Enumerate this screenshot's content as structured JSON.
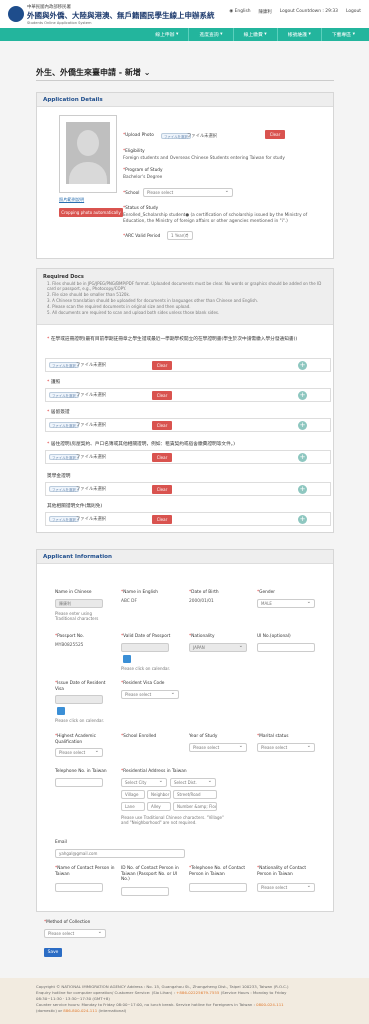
{
  "header": {
    "agency_zh": "中華民國內政部移民署",
    "system_zh": "外國與外僑、大陸與港澳、無戶籍國民學生線上申辦系統",
    "system_en": "Students Online Application System",
    "lang": "English",
    "user": "陳康利",
    "countdown_label": "Logout Countdown : 29:33",
    "logout": "Logout"
  },
  "nav": [
    "線上申辦",
    "進度查詢",
    "線上繳費",
    "帳號維護",
    "下載專區"
  ],
  "page_title": "外生、外僑生來臺申請 - 新增",
  "details": {
    "heading": "Application Details",
    "upload_photo_label": "Upload Photo",
    "upload_chip": "ファイルを選択",
    "upload_value": "ファイル未選択",
    "clear": "Clear",
    "photo_hint": "照片範例說明",
    "crop_button": "Cropping photo automatically",
    "eligibility_label": "Eligibility",
    "eligibility_value": "Foreign students and Overseas Chinese Students entering Taiwan for study",
    "program_label": "Program of Study",
    "program_value": "Bachelor's Degree",
    "school_label": "School",
    "school_value": "Please select",
    "status_label": "Status of Study",
    "status_value": "Enrolled_Scholarship student",
    "status_note": "(a certification of scholarship issued by the Ministry of Education, the Ministry of foreign affairs or other agencies mentioned in \"i\".)",
    "arc_label": "ARC Valid Period",
    "arc_value": "1 Year(s)"
  },
  "required_docs": {
    "heading": "Required Docs",
    "items": [
      "1. Files should be in JPG/JPEG/PNG/BMP/PDF format. Uploaded documents must be clear. No words or graphics should be added on the ID card or passport, e.g., Photocopy/COPY.",
      "2. File size should be smaller than 5120k.",
      "3. A Chinese translation should be uploaded for documents in languages other than Chinese and English.",
      "4. Please scan the required documents in original size and then upload.",
      "5. All documents are required to scan and upload both sides unless those blank sides."
    ]
  },
  "docs": [
    {
      "label": "在學或註冊證明(最有目前學期註冊章之學生證或最近一學期學校開立的在學證明書(學生於次中請需繳入學分發通知書))",
      "required": true,
      "file": "ファイル未選択",
      "chip": "ファイルを選択",
      "clear": "Clear"
    },
    {
      "label": "護照",
      "required": true,
      "file": "ファイル未選択",
      "chip": "ファイルを選択",
      "clear": "Clear"
    },
    {
      "label": "居留簽證",
      "required": true,
      "file": "ファイル未選択",
      "chip": "ファイルを選択",
      "clear": "Clear"
    },
    {
      "label": "居住證明(房屋契約、戶口名簿或其他相關證明，例如：租賃契約或宿舍繳費證明等文件。)",
      "required": true,
      "file": "ファイル未選択",
      "chip": "ファイルを選択",
      "clear": "Clear"
    },
    {
      "label": "獎學金證明",
      "required": false,
      "file": "ファイル未選択",
      "chip": "ファイルを選択",
      "clear": "Clear"
    },
    {
      "label": "其他相關證明文件(無則免)",
      "required": false,
      "file": "ファイル未選択",
      "chip": "ファイルを選択",
      "clear": "Clear"
    }
  ],
  "applicant": {
    "heading": "Applicant Information",
    "name_zh_label": "Name in Chinese",
    "name_zh_value": "陳康利",
    "name_zh_hint": "Please enter using Traditional characters",
    "name_en_label": "Name in English",
    "name_en_value": "ABC DF",
    "dob_label": "Date of Birth",
    "dob_value": "2000/01/01",
    "gender_label": "Gender",
    "gender_value": "MALE",
    "passport_label": "Passport No.",
    "passport_value": "MYB0825525",
    "valid_passport_label": "Valid Date of Passport",
    "calendar_hint": "Please click on calendar.",
    "nationality_label": "Nationality",
    "nationality_value": "JAPAN",
    "ui_label": "UI No.(optional)",
    "issue_label": "Issue Date of Resident Visa",
    "visa_code_label": "Resident Visa Code",
    "visa_code_value": "Please select",
    "calendar_hint2": "Please click on calendar.",
    "edu_label": "Highest Academic Qualification",
    "edu_value": "Please select",
    "school_enrolled_label": "School Enrolled",
    "year_label": "Year of Study",
    "year_value": "Please select",
    "marital_label": "Marital status",
    "marital_value": "Please select",
    "tel_label": "Telephone No. in Taiwan",
    "addr_label": "Residential Address in Taiwan",
    "addr_city": "Select City",
    "addr_dist": "Select Dist.",
    "addr_village": "Village",
    "addr_neighbor": "Neighbor",
    "addr_street": "Street/Road",
    "addr_lane": "Lane",
    "addr_alley": "Alley",
    "addr_number": "Number &amp; Floor",
    "addr_hint": "Please use Traditional Chinese characters. \"Village\" and \"Neighborhood\" are not required.",
    "email_label": "Email",
    "email_value": "yahgal@gmail.com",
    "contact_name_label": "Name of Contact Person in Taiwan",
    "contact_id_label": "ID No. of Contact Person in Taiwan (Passport No. or UI No.)",
    "contact_tel_label": "Telephone No. of Contact Person in Taiwan",
    "contact_nat_label": "Nationality of Contact Person in Taiwan",
    "contact_nat_value": "Please select"
  },
  "collection": {
    "label": "Method of Collection",
    "value": "Please select"
  },
  "save": "Save",
  "footer": {
    "line1": "Copyright © NATIONAL IMMIGRATION AGENCY Address : No. 15, Guangzhou St., Zhongzheng Dist., Taipei 100233, Taiwan (R.O.C.)",
    "line2a": "Enquiry hotline for computer operation/ Customer Service: (Sio Lihan) : ",
    "line2b": "+886-02225679-7555",
    "line2c": " (Service Hours : Monday to Friday",
    "line3": "08:30~11:30 · 13:30~17:30 (GMT+8)",
    "line4a": "Counter service hours: Monday to Friday 08:00~17:00, no lunch break. Service hotline for Foreigners in Taiwan : ",
    "line4b": "0800-024-111",
    "line5a": "(domestic) or ",
    "line5b": "886-800-024-111",
    "line5c": " (international)"
  }
}
